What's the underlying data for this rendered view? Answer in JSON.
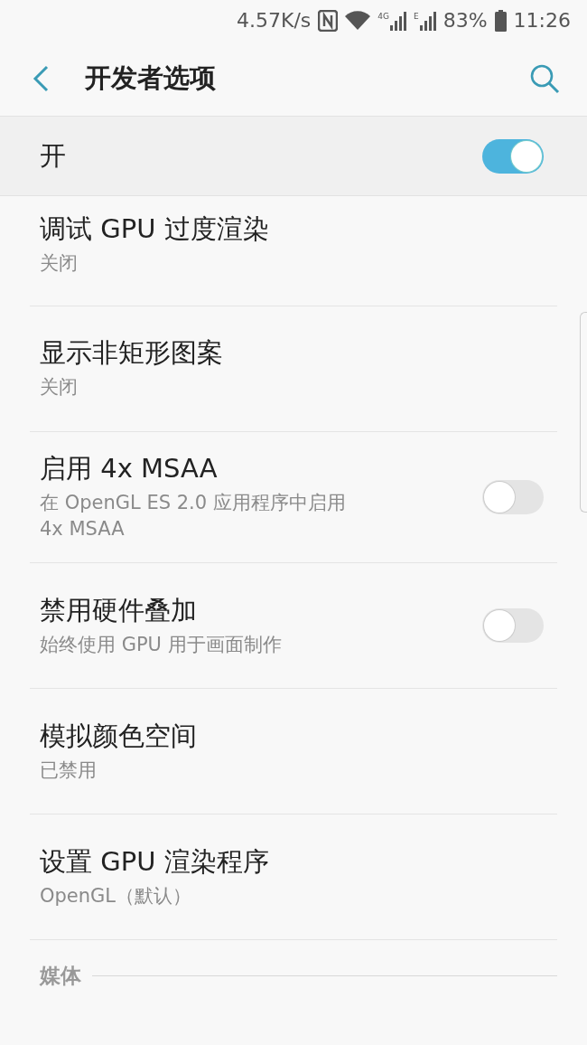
{
  "status_bar": {
    "speed": "4.57K/s",
    "network_1": "4G",
    "network_2": "E",
    "battery": "83%",
    "time": "11:26"
  },
  "toolbar": {
    "title": "开发者选项"
  },
  "master_switch": {
    "label": "开",
    "on": true
  },
  "items": [
    {
      "kind": "info",
      "title": "调试 GPU 过度渲染",
      "summary": "关闭"
    },
    {
      "kind": "info",
      "title": "显示非矩形图案",
      "summary": "关闭"
    },
    {
      "kind": "switch",
      "title": "启用 4x MSAA",
      "summary": "在 OpenGL ES 2.0 应用程序中启用 4x MSAA",
      "on": false
    },
    {
      "kind": "switch",
      "title": "禁用硬件叠加",
      "summary": "始终使用 GPU 用于画面制作",
      "on": false
    },
    {
      "kind": "info",
      "title": "模拟颜色空间",
      "summary": "已禁用"
    },
    {
      "kind": "info",
      "title": "设置 GPU 渲染程序",
      "summary": "OpenGL（默认）"
    }
  ],
  "section_header": "媒体"
}
